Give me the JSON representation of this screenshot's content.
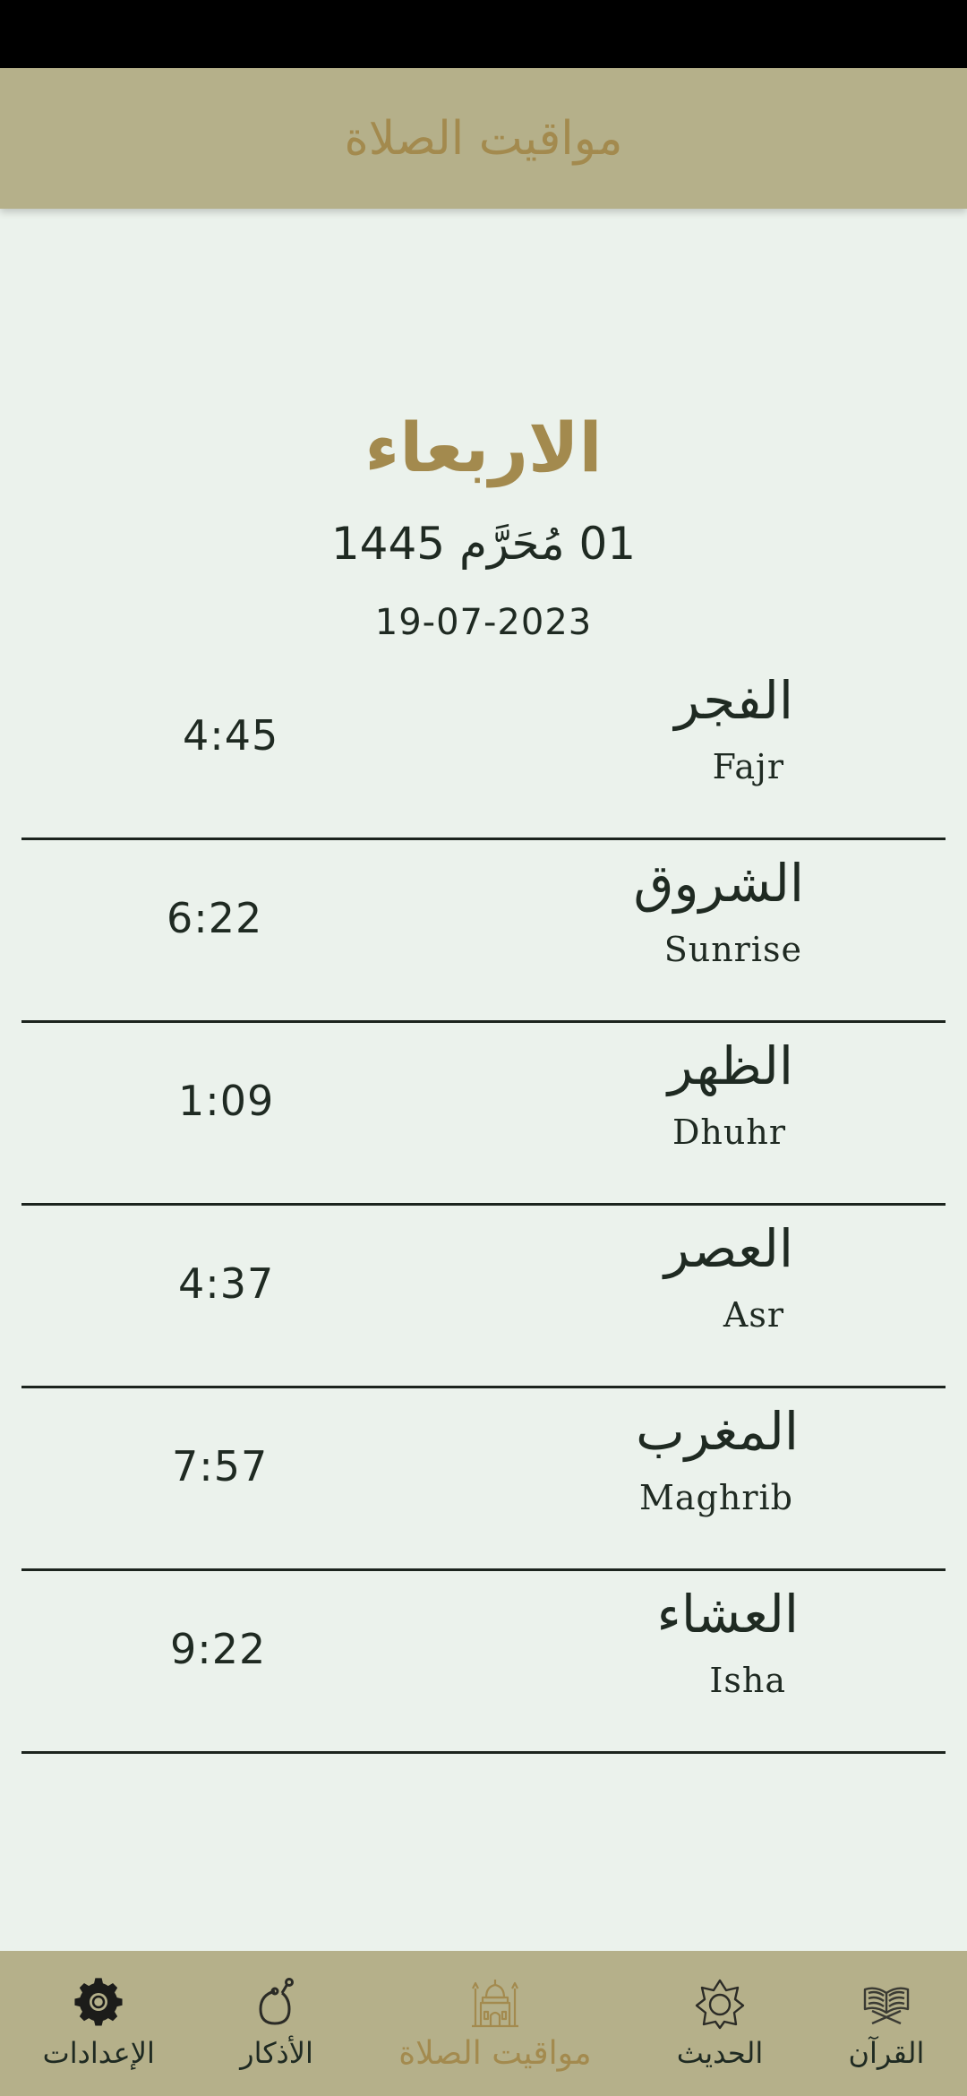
{
  "header": {
    "title": "مواقيت الصلاة"
  },
  "date": {
    "day_name": "الاربعاء",
    "hijri": "01 مُحَرَّم 1445",
    "gregorian": "19-07-2023"
  },
  "prayers": [
    {
      "name_ar": "الفجر",
      "name_en": "Fajr",
      "time": "4:45"
    },
    {
      "name_ar": "الشروق",
      "name_en": "Sunrise",
      "time": "6:22"
    },
    {
      "name_ar": "الظهر",
      "name_en": "Dhuhr",
      "time": "1:09"
    },
    {
      "name_ar": "العصر",
      "name_en": "Asr",
      "time": "4:37"
    },
    {
      "name_ar": "المغرب",
      "name_en": "Maghrib",
      "time": "7:57"
    },
    {
      "name_ar": "العشاء",
      "name_en": "Isha",
      "time": "9:22"
    }
  ],
  "bottom_nav": {
    "items": [
      {
        "label": "القرآن",
        "icon": "quran-icon"
      },
      {
        "label": "الحديث",
        "icon": "star-icon"
      },
      {
        "label": "مواقيت الصلاة",
        "icon": "mosque-icon",
        "active": true
      },
      {
        "label": "الأذكار",
        "icon": "prayer-beads-icon"
      },
      {
        "label": "الإعدادات",
        "icon": "gear-icon"
      }
    ]
  },
  "colors": {
    "accent": "#a38a4e",
    "bar_bg": "#b5b08a",
    "page_bg": "#ebf2ec",
    "text": "#1f2a22"
  }
}
